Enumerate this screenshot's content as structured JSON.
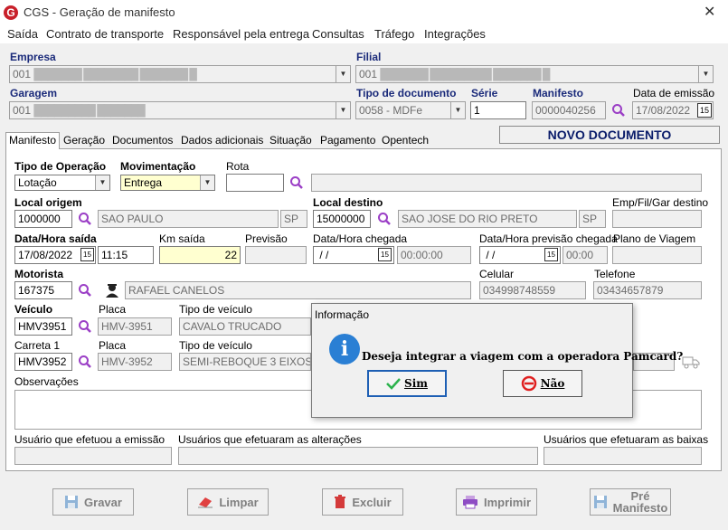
{
  "window": {
    "title": "CGS - Geração de manifesto",
    "close": "✕"
  },
  "menu": [
    "Saída",
    "Contrato de transporte",
    "Responsável pela entrega",
    "Consultas",
    "Tráfego",
    "Integrações"
  ],
  "header": {
    "empresa_label": "Empresa",
    "empresa_value": "001",
    "empresa_blur": "███████ ████████ ███████ █",
    "filial_label": "Filial",
    "filial_value": "001",
    "filial_blur": "███████ █████████ ███████ █",
    "garagem_label": "Garagem",
    "garagem_value": "001",
    "garagem_blur": "█████████ ███████",
    "tipo_doc_label": "Tipo de documento",
    "tipo_doc_value": "0058 - MDFe",
    "serie_label": "Série",
    "serie_value": "1",
    "manifesto_label": "Manifesto",
    "manifesto_value": "0000040256",
    "data_emissao_label": "Data de emissão",
    "data_emissao_value": "17/08/2022",
    "status": "NOVO DOCUMENTO"
  },
  "tabs": [
    "Manifesto",
    "Geração",
    "Documentos",
    "Dados adicionais",
    "Situação",
    "Pagamento",
    "Opentech"
  ],
  "form": {
    "tipo_op_label": "Tipo de Operação",
    "tipo_op_value": "Lotação",
    "movimentacao_label": "Movimentação",
    "movimentacao_value": "Entrega",
    "rota_label": "Rota",
    "local_origem_label": "Local origem",
    "local_origem_code": "1000000",
    "local_origem_city": "SAO PAULO",
    "local_origem_uf": "SP",
    "local_destino_label": "Local destino",
    "local_destino_code": "15000000",
    "local_destino_city": "SAO JOSE DO RIO PRETO",
    "local_destino_uf": "SP",
    "emp_destino_label": "Emp/Fil/Gar destino",
    "data_saida_label": "Data/Hora saída",
    "data_saida_date": "17/08/2022",
    "data_saida_time": "11:15",
    "km_saida_label": "Km saída",
    "km_saida_value": "22",
    "previsao_label": "Previsão",
    "data_chegada_label": "Data/Hora chegada",
    "data_chegada_date": " / /",
    "data_chegada_time": "00:00:00",
    "data_prev_chegada_label": "Data/Hora previsão chegada",
    "data_prev_chegada_date": " / /",
    "data_prev_chegada_time": "00:00",
    "plano_viagem_label": "Plano de Viagem",
    "motorista_label": "Motorista",
    "motorista_code": "167375",
    "motorista_name": "RAFAEL CANELOS",
    "celular_label": "Celular",
    "celular_value": "034998748559",
    "telefone_label": "Telefone",
    "telefone_value": "03434657879",
    "veiculo_label": "Veículo",
    "veiculo_code": "HMV3951",
    "placa_label": "Placa",
    "veiculo_placa": "HMV-3951",
    "tipo_veiculo_label": "Tipo de veículo",
    "veiculo_tipo": "CAVALO TRUCADO",
    "carreta_label": "Carreta 1",
    "carreta_code": "HMV3952",
    "carreta_placa": "HMV-3952",
    "carreta_tipo": "SEMI-REBOQUE 3 EIXOS",
    "observacoes_label": "Observações",
    "usuario_emissao_label": "Usuário que efetuou a emissão",
    "usuario_alteracoes_label": "Usuários que efetuaram as alterações",
    "usuario_baixas_label": "Usuários que efetuaram as baixas",
    "date_btn": "15"
  },
  "buttons": {
    "gravar": "Gravar",
    "limpar": "Limpar",
    "excluir": "Excluir",
    "imprimir": "Imprimir",
    "pre_manifesto_1": "Pré",
    "pre_manifesto_2": "Manifesto"
  },
  "dialog": {
    "title": "Informação",
    "icon": "i",
    "message": "Deseja integrar a viagem com a operadora Pamcard?",
    "yes": "Sim",
    "no": "Não"
  },
  "colors": {
    "accent_blue": "#1a2a7a",
    "dialog_info": "#2a7fd4",
    "status_text": "#0a1c6a"
  }
}
